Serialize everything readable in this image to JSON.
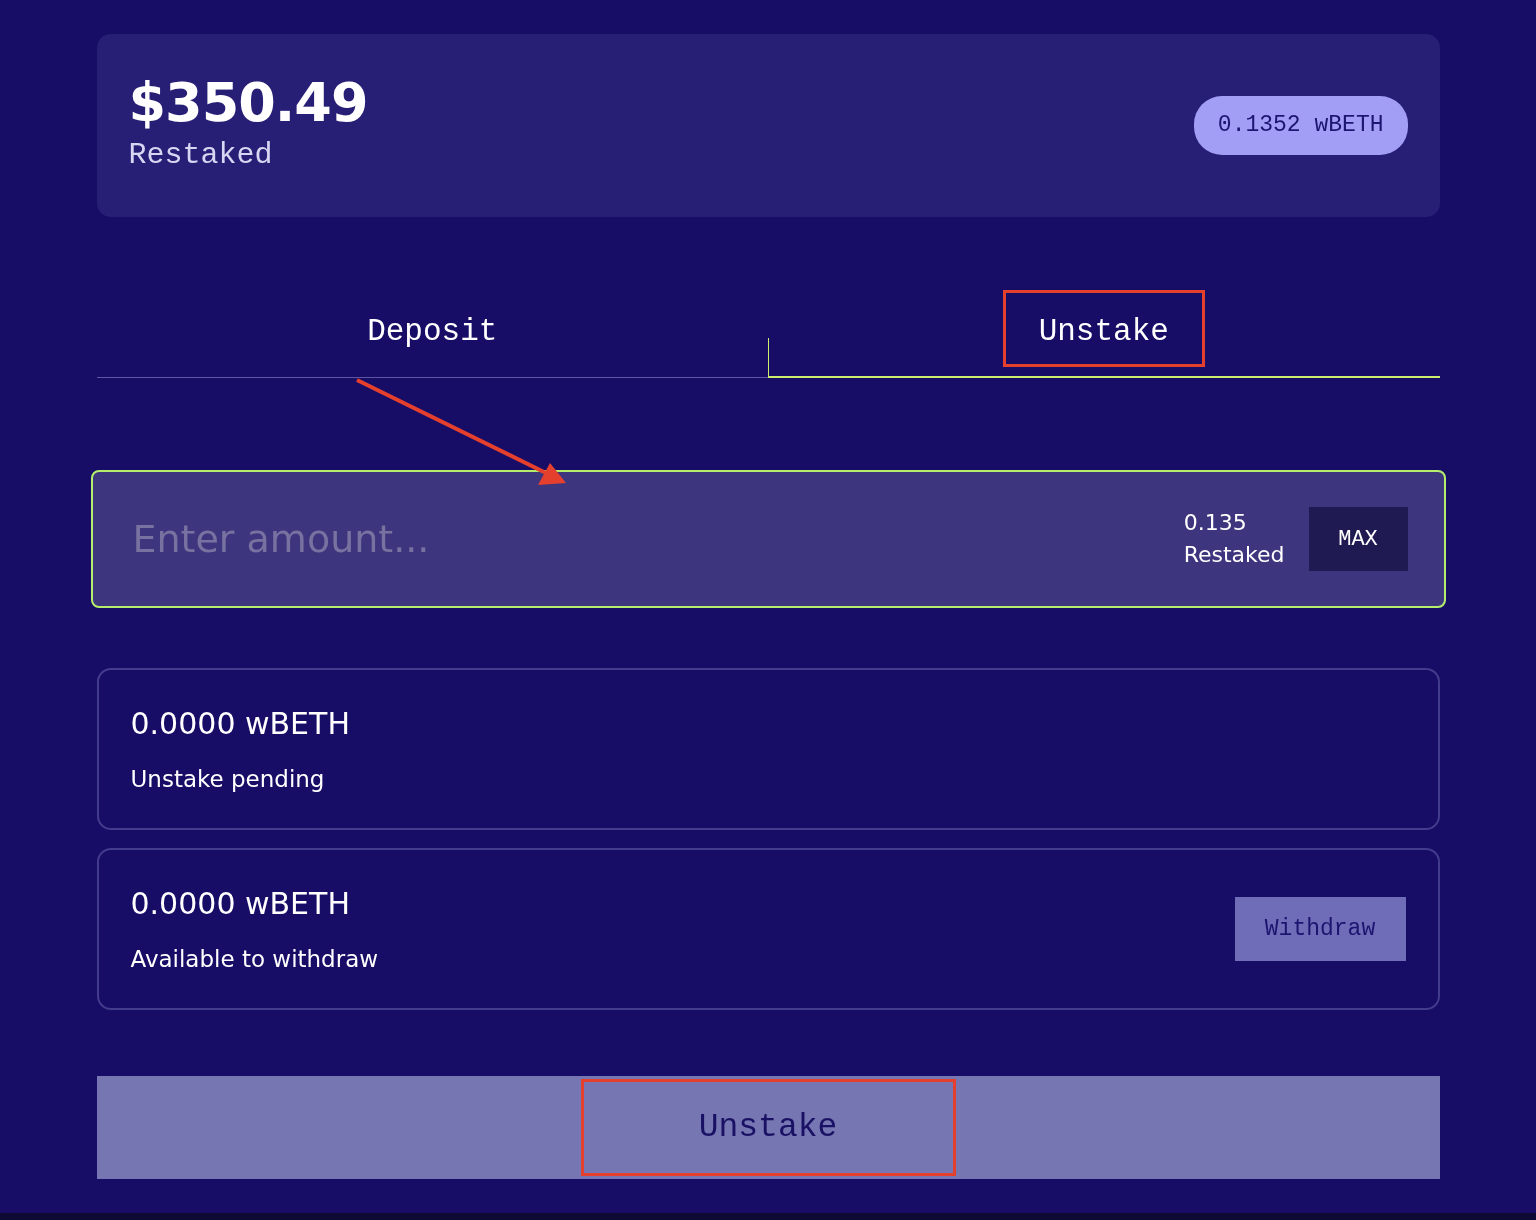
{
  "balance_card": {
    "amount": "$350.49",
    "label": "Restaked",
    "token_badge": "0.1352 wBETH"
  },
  "tabs": [
    {
      "label": "Deposit",
      "selected": false,
      "highlighted": false
    },
    {
      "label": "Unstake",
      "selected": true,
      "highlighted": true
    }
  ],
  "amount_field": {
    "placeholder": "Enter amount...",
    "balance": "0.135",
    "balance_label": "Restaked",
    "max_button": "MAX",
    "focused": true
  },
  "status_cards": [
    {
      "amount": "0.0000 wBETH",
      "label": "Unstake pending"
    },
    {
      "amount": "0.0000 wBETH",
      "label": "Available to withdraw",
      "action": {
        "label": "Withdraw",
        "disabled": true
      }
    }
  ],
  "submit_button": {
    "label": "Unstake",
    "disabled": true,
    "highlighted": true
  },
  "pointer_arrow": true
}
